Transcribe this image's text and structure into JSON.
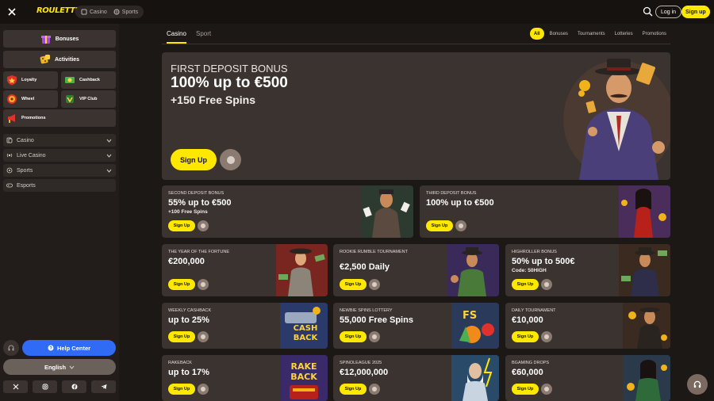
{
  "topbar": {
    "logo": "ROULETTINO",
    "nav": [
      {
        "label": "Casino",
        "icon": "casino-icon"
      },
      {
        "label": "Sports",
        "icon": "sports-icon"
      }
    ],
    "login_label": "Log in",
    "signup_label": "Sign up"
  },
  "sidebar": {
    "big_items": [
      {
        "label": "Bonuses",
        "icon": "gift-icon"
      },
      {
        "label": "Activities",
        "icon": "dice-icon"
      }
    ],
    "small_items": [
      {
        "label": "Loyalty",
        "icon": "shield-icon"
      },
      {
        "label": "Cashback",
        "icon": "cashback-icon"
      },
      {
        "label": "Wheel",
        "icon": "wheel-icon"
      },
      {
        "label": "VIP Club",
        "icon": "vip-icon"
      }
    ],
    "promotions_label": "Promotions",
    "nav": [
      {
        "label": "Casino",
        "icon": "cards-icon",
        "expandable": true
      },
      {
        "label": "Live Casino",
        "icon": "live-icon",
        "expandable": true
      },
      {
        "label": "Sports",
        "icon": "ball-icon",
        "expandable": true
      },
      {
        "label": "Esports",
        "icon": "gamepad-icon",
        "expandable": false
      }
    ],
    "help_label": "Help Center",
    "language": "English",
    "socials": [
      "x-icon",
      "instagram-icon",
      "facebook-icon",
      "telegram-icon"
    ]
  },
  "tabs": [
    {
      "label": "Casino",
      "active": true
    },
    {
      "label": "Sport",
      "active": false
    }
  ],
  "filters": [
    {
      "label": "All",
      "active": true
    },
    {
      "label": "Bonuses",
      "active": false
    },
    {
      "label": "Tournaments",
      "active": false
    },
    {
      "label": "Lotteries",
      "active": false
    },
    {
      "label": "Promotions",
      "active": false
    }
  ],
  "hero": {
    "subtitle": "FIRST DEPOSIT BONUS",
    "title": "100% up to  €500",
    "extra": "+150 Free Spins",
    "button": "Sign Up"
  },
  "cards": [
    {
      "sub": "SECOND DEPOSIT BONUS",
      "title": "55% up to €500",
      "extra": "+100 Free Spins",
      "button": "Sign Up"
    },
    {
      "sub": "THIRD DEPOSIT BONUS",
      "title": "100% up to €500",
      "extra": "",
      "button": "Sign Up"
    },
    {
      "sub": "THE YEAR OF THE FORTUNE",
      "title": "€200,000",
      "extra": "",
      "button": "Sign Up"
    },
    {
      "sub": "ROOKIE RUMBLE TOURNAMENT",
      "title": "€2,500 Daily",
      "extra": "",
      "button": "Sign Up"
    },
    {
      "sub": "HIGHROLLER BONUS",
      "title": "50% up to 500€",
      "extra": "Code: 50HIGH",
      "button": "Sign Up"
    },
    {
      "sub": "WEEKLY CASHBACK",
      "title": "up to 25%",
      "extra": "",
      "button": "Sign Up"
    },
    {
      "sub": "NEWBIE SPINS LOTTERY",
      "title": "55,000 Free Spins",
      "extra": "",
      "button": "Sign Up"
    },
    {
      "sub": "DAILY TOURNAMENT",
      "title": "€10,000",
      "extra": "",
      "button": "Sign Up"
    },
    {
      "sub": "RAKEBACK",
      "title": "up to 17%",
      "extra": "",
      "button": "Sign Up"
    },
    {
      "sub": "SPINOLEAGUE 2025",
      "title": "€12,000,000",
      "extra": "",
      "button": "Sign Up"
    },
    {
      "sub": "BGAMING DROPS",
      "title": "€60,000",
      "extra": "",
      "button": "Sign Up"
    }
  ],
  "art_text": {
    "cashback": "CASH BACK",
    "rakeback": "RAKE BACK",
    "fs": "FS"
  },
  "colors": {
    "accent": "#ffe800",
    "help": "#2f6bf5",
    "card": "#3a332f",
    "bg": "#1c1816"
  }
}
